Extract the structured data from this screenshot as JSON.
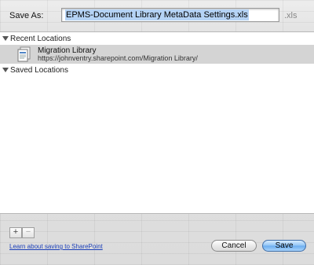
{
  "save_as": {
    "label": "Save As:",
    "filename": "EPMS-Document Library MetaData Settings.xls",
    "selected_text": "EPMS-Document Library MetaData Settings.xls",
    "extension": ".xls"
  },
  "browser": {
    "recent_header": "Recent Locations",
    "recent_items": [
      {
        "name": "Migration Library",
        "url": "https://johnventry.sharepoint.com/Migration Library/",
        "icon": "document-library-icon"
      }
    ],
    "saved_header": "Saved Locations"
  },
  "footer": {
    "add_label": "+",
    "remove_label": "−",
    "learn_link": "Learn about saving to SharePoint",
    "cancel_label": "Cancel",
    "save_label": "Save"
  },
  "colors": {
    "selection": "#b5d3f5",
    "link": "#1b3fb8",
    "default_button": "#69acef",
    "selected_row": "#d4d4d4"
  }
}
